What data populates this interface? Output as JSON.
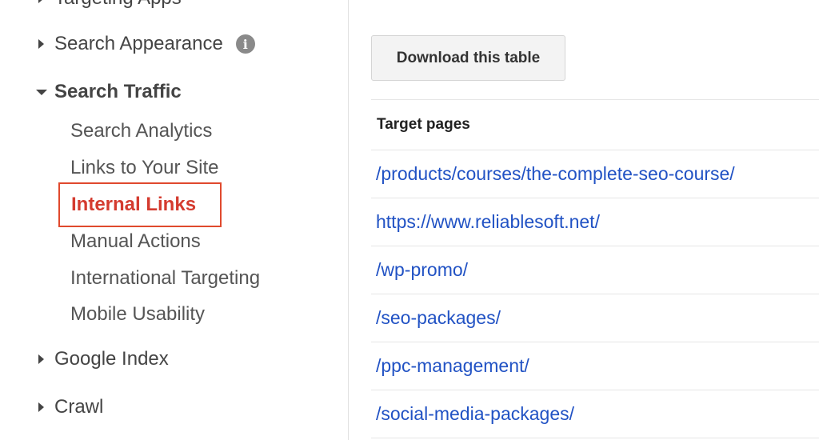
{
  "sidebar": {
    "cut_item_label": "Targeting Apps",
    "sections": {
      "search_appearance": {
        "label": "Search Appearance",
        "info_icon": "info-icon"
      },
      "search_traffic": {
        "label": "Search Traffic",
        "items": [
          {
            "label": "Search Analytics"
          },
          {
            "label": "Links to Your Site"
          },
          {
            "label": "Internal Links",
            "active": true
          },
          {
            "label": "Manual Actions"
          },
          {
            "label": "International Targeting"
          },
          {
            "label": "Mobile Usability"
          }
        ]
      },
      "google_index": {
        "label": "Google Index"
      },
      "crawl": {
        "label": "Crawl"
      }
    },
    "colors": {
      "active_text": "#d43b2f",
      "active_border": "#e0492d"
    }
  },
  "main": {
    "download_button_label": "Download this table",
    "table": {
      "header": "Target pages",
      "rows": [
        "/products/courses/the-complete-seo-course/",
        "https://www.reliablesoft.net/",
        "/wp-promo/",
        "/seo-packages/",
        "/ppc-management/",
        "/social-media-packages/"
      ]
    },
    "colors": {
      "link": "#2152c4"
    }
  }
}
